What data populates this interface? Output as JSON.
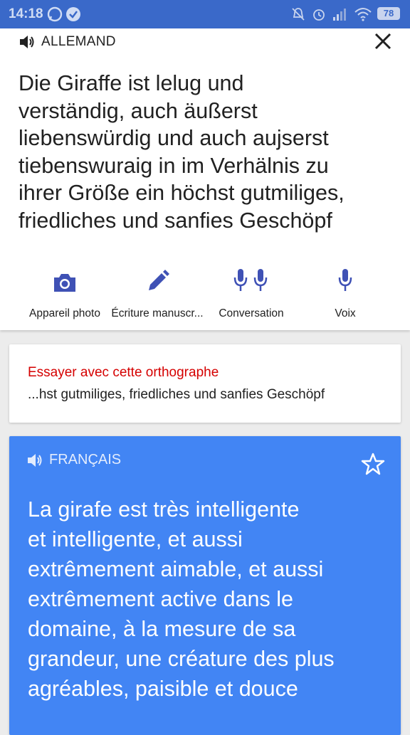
{
  "status_bar": {
    "time": "14:18",
    "battery": "78"
  },
  "source": {
    "language": "ALLEMAND",
    "text": "Die Giraffe ist lelug und\nverständig, auch äußerst\nliebenswürdig und auch aujserst\ntiebenswuraig in im Verhälnis zu\nihrer Größe ein höchst gutmiliges,\nfriedliches und sanfies Geschöpf"
  },
  "tools": [
    {
      "label": "Appareil photo",
      "icon": "camera-icon"
    },
    {
      "label": "Écriture manuscr...",
      "icon": "pen-icon"
    },
    {
      "label": "Conversation",
      "icon": "two-mic-icon"
    },
    {
      "label": "Voix",
      "icon": "mic-icon"
    }
  ],
  "suggestion": {
    "title": "Essayer avec cette orthographe",
    "text": "...hst gutmiliges, friedliches und sanfies Geschöpf"
  },
  "translation": {
    "language": "FRANÇAIS",
    "text": "La girafe est très intelligente\net intelligente, et aussi\nextrêmement aimable, et aussi\nextrêmement active dans le\ndomaine, à la mesure de sa\ngrandeur, une créature des plus\nagréables, paisible et douce"
  },
  "colors": {
    "status_bar": "#3a69c9",
    "accent": "#3f51b5",
    "translation_card": "#4285f4",
    "suggestion_title": "#d50000"
  }
}
